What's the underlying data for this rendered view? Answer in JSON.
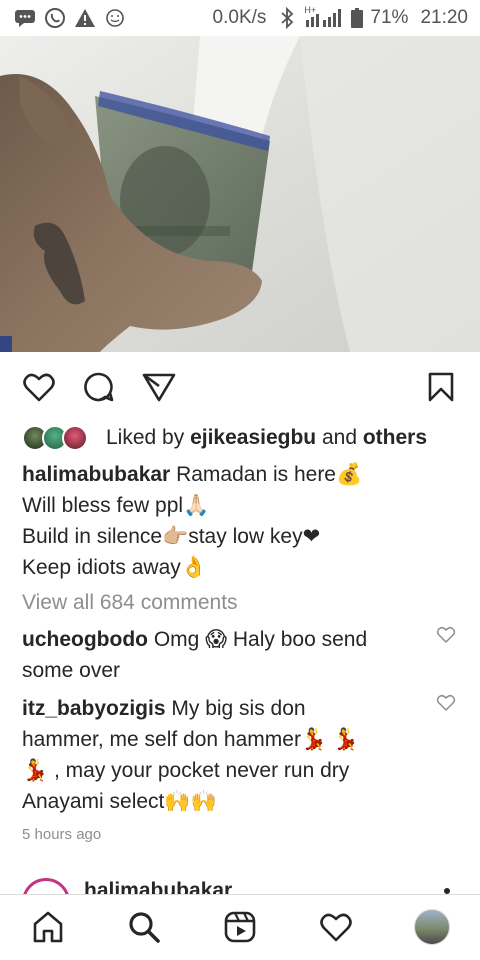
{
  "status_bar": {
    "network_speed": "0.0K/s",
    "signal_label": "H+",
    "battery": "71%",
    "time": "21:20",
    "icons": [
      "chat-icon",
      "whatsapp-icon",
      "warning-icon",
      "emoji-icon",
      "bluetooth-icon",
      "signal-icon",
      "battery-icon"
    ]
  },
  "post": {
    "likes": {
      "prefix": "Liked by ",
      "user": "ejikeasiegbu",
      "and": " and ",
      "others": "others"
    },
    "caption": {
      "username": "halimabubakar",
      "line1": " Ramadan is here💰",
      "line2": "Will bless few ppl🙏🏻",
      "line3": "Build in silence👉🏼stay low key❤",
      "line4": "Keep idiots away👌"
    },
    "view_all_comments": "View all 684 comments",
    "comments": [
      {
        "username": "ucheogbodo",
        "line1": " Omg 😱 Haly boo send",
        "line2": "some over"
      },
      {
        "username": "itz_babyozigis",
        "line1": " My big sis don",
        "line2": "hammer, me self don hammer💃 💃",
        "line3": "💃 , may your pocket never run dry",
        "line4": "Anayami select🙌🙌"
      }
    ],
    "timestamp": "5 hours ago"
  },
  "next_post": {
    "username": "halimabubakar"
  },
  "bottom_nav": {
    "items": [
      "home-icon",
      "search-icon",
      "reels-icon",
      "activity-icon",
      "profile-avatar"
    ]
  },
  "colors": {
    "text": "#262626",
    "secondary": "#8e8e8e",
    "divider": "#dbdbdb",
    "story_ring": "#c13584"
  }
}
